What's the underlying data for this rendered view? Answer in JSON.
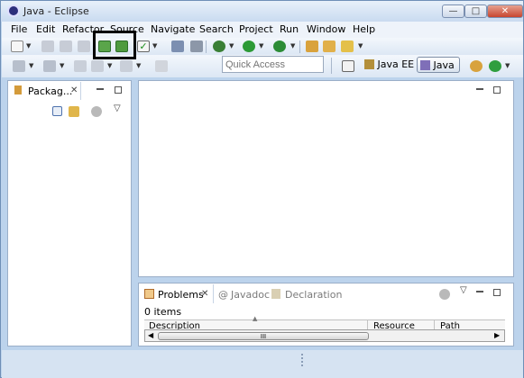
{
  "window": {
    "title": "Java - Eclipse",
    "controls": {
      "minimize": "—",
      "maximize": "□",
      "close": "✕"
    }
  },
  "menubar": {
    "items": [
      "File",
      "Edit",
      "Refactor",
      "Source",
      "Navigate",
      "Search",
      "Project",
      "Run",
      "Window",
      "Help"
    ]
  },
  "toolbar": {
    "quick_access_placeholder": "Quick Access",
    "perspectives": [
      {
        "label": "Java EE",
        "active": false
      },
      {
        "label": "Java",
        "active": true
      }
    ],
    "icons": [
      "new-icon",
      "save-icon",
      "save-all-icon",
      "print-icon",
      "import-icon",
      "export-icon",
      "checkbox-icon",
      "refresh-icon",
      "debug-icon",
      "run-icon",
      "external-tools-icon",
      "open-type-icon",
      "open-folder-icon",
      "search-icon"
    ]
  },
  "package_explorer": {
    "tab_label": "Packag...",
    "close": "✕"
  },
  "bottom_panel": {
    "tabs": [
      {
        "label": "Problems",
        "active": true
      },
      {
        "label": "Javadoc",
        "active": false
      },
      {
        "label": "Declaration",
        "active": false
      }
    ],
    "summary": "0 items",
    "columns": [
      "Description",
      "Resource",
      "Path"
    ],
    "scroll_grip": "III",
    "close": "✕"
  },
  "colors": {
    "window_frame": "#bcd3ec",
    "selection_highlight": "#000000",
    "active_tab_bg": "#ffffff"
  }
}
